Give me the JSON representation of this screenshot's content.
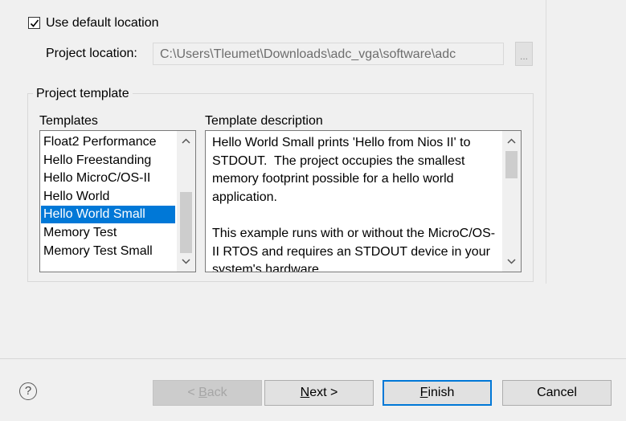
{
  "location": {
    "use_default_label": "Use default location",
    "use_default_checked": true,
    "project_location_label": "Project location:",
    "project_location_value": "C:\\Users\\Tleumet\\Downloads\\adc_vga\\software\\adc",
    "browse_label": "..."
  },
  "template_group": {
    "legend": "Project template",
    "templates_label": "Templates",
    "description_label": "Template description",
    "templates": [
      "Float2 Performance",
      "Hello Freestanding",
      "Hello MicroC/OS-II",
      "Hello World",
      "Hello World Small",
      "Memory Test",
      "Memory Test Small"
    ],
    "selected_template": "Hello World Small",
    "description": "Hello World Small prints 'Hello from Nios II' to STDOUT.  The project occupies the smallest memory footprint possible for a hello world application.\n\nThis example runs with or without the MicroC/OS-II RTOS and requires an STDOUT device in your system's hardware."
  },
  "buttons": {
    "help_glyph": "?",
    "back": {
      "pre": "< ",
      "mnemonic": "B",
      "post": "ack"
    },
    "next": {
      "pre": "",
      "mnemonic": "N",
      "post": "ext >"
    },
    "finish": {
      "pre": "",
      "mnemonic": "F",
      "post": "inish"
    },
    "cancel": "Cancel"
  }
}
